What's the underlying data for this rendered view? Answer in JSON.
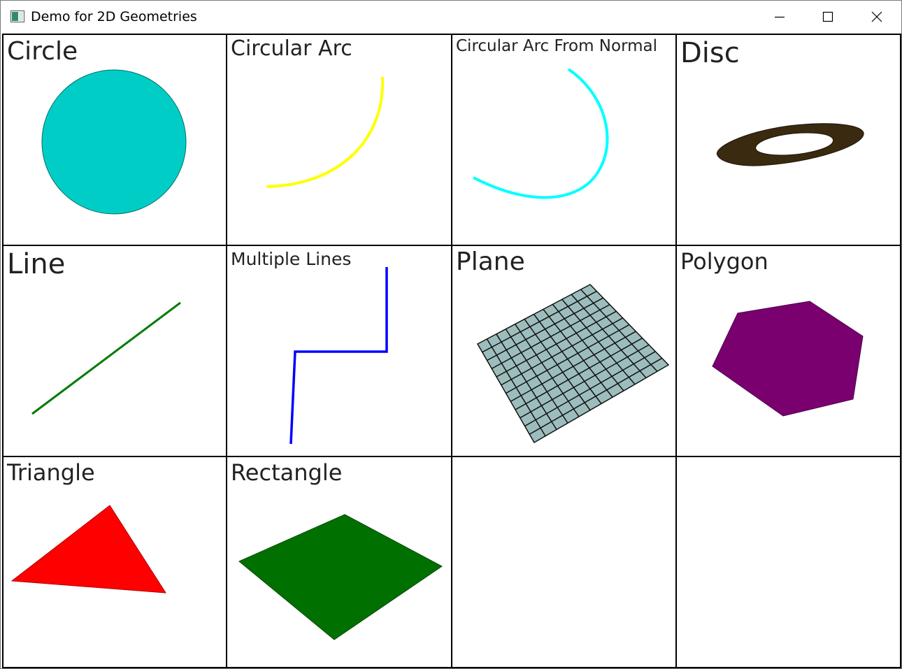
{
  "window": {
    "title": "Demo for 2D Geometries",
    "controls": {
      "minimize": "minimize-icon",
      "maximize": "maximize-icon",
      "close": "close-icon"
    }
  },
  "cells": [
    {
      "label": "Circle",
      "color": "#00cec6"
    },
    {
      "label": "Circular Arc",
      "color": "#ffff00"
    },
    {
      "label": "Circular Arc From Normal",
      "color": "#00ffff"
    },
    {
      "label": "Disc",
      "color": "#3a2a10"
    },
    {
      "label": "Line",
      "color": "#007a00"
    },
    {
      "label": "Multiple Lines",
      "color": "#0000ff"
    },
    {
      "label": "Plane",
      "color": "#9dbdbd"
    },
    {
      "label": "Polygon",
      "color": "#7a0070"
    },
    {
      "label": "Triangle",
      "color": "#ff0000"
    },
    {
      "label": "Rectangle",
      "color": "#007000"
    },
    {
      "label": "",
      "color": ""
    },
    {
      "label": "",
      "color": ""
    }
  ]
}
